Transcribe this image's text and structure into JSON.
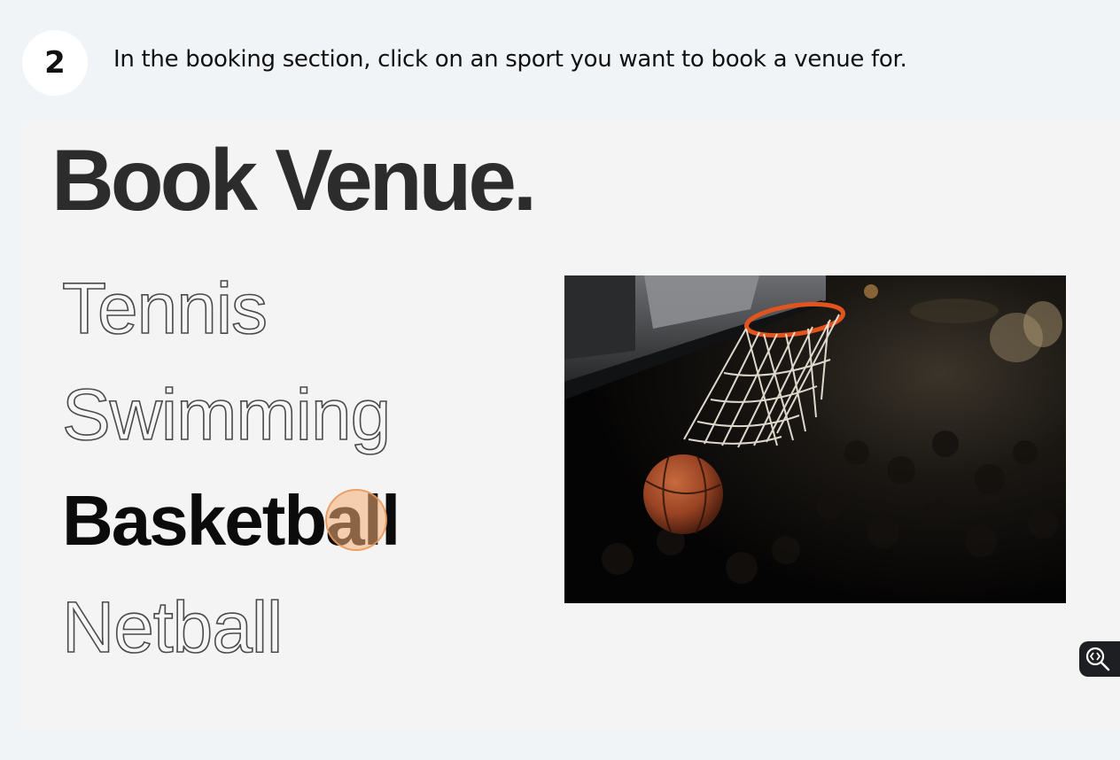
{
  "step": {
    "number": "2",
    "instruction": "In the booking section, click on an sport you want to book a venue for."
  },
  "screenshot": {
    "heading": "Book Venue.",
    "sports": [
      {
        "label": "Tennis",
        "selected": false
      },
      {
        "label": "Swimming",
        "selected": false
      },
      {
        "label": "Basketball",
        "selected": true
      },
      {
        "label": "Netball",
        "selected": false
      }
    ],
    "image_icon": "basketball-hoop-photo"
  },
  "zoom_button": {
    "icon": "zoom-code-icon"
  },
  "colors": {
    "page_background": "#f1f4f7",
    "screenshot_background": "#f4f4f4",
    "heading": "#2c2c2c",
    "selected_sport": "#0b0b0b",
    "outline_stroke": "#4a4a4a",
    "click_marker": "#f6af78",
    "hoop_rim": "#e2541f"
  }
}
